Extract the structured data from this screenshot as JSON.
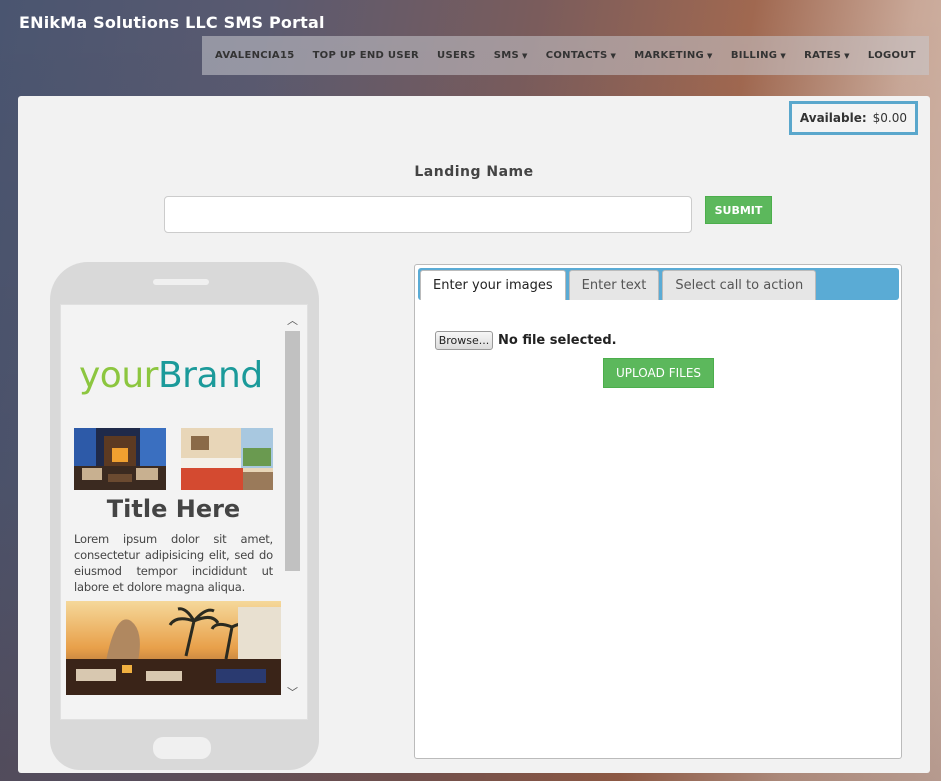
{
  "header": {
    "title": "ENikMa Solutions LLC SMS Portal"
  },
  "nav": {
    "items": [
      {
        "label": "AVALENCIA15",
        "dropdown": false
      },
      {
        "label": "TOP UP END USER",
        "dropdown": false
      },
      {
        "label": "USERS",
        "dropdown": false
      },
      {
        "label": "SMS",
        "dropdown": true
      },
      {
        "label": "CONTACTS",
        "dropdown": true
      },
      {
        "label": "MARKETING",
        "dropdown": true
      },
      {
        "label": "BILLING",
        "dropdown": true
      },
      {
        "label": "RATES",
        "dropdown": true
      },
      {
        "label": "LOGOUT",
        "dropdown": false
      }
    ]
  },
  "balance": {
    "label": "Available:",
    "value": "$0.00"
  },
  "landing": {
    "label": "Landing Name",
    "input_value": "",
    "submit_label": "SUBMIT"
  },
  "preview": {
    "brand_part1": "your",
    "brand_part2": "Brand",
    "title": "Title Here",
    "body": "Lorem ipsum dolor sit amet, consectetur adipisicing elit, sed do eiusmod tempor incididunt ut labore et dolore magna aliqua."
  },
  "tabs": [
    {
      "label": "Enter your images",
      "active": true
    },
    {
      "label": "Enter text",
      "active": false
    },
    {
      "label": "Select call to action",
      "active": false
    }
  ],
  "upload": {
    "browse_label": "Browse...",
    "file_status": "No file selected.",
    "upload_label": "UPLOAD FILES"
  },
  "colors": {
    "success": "#5cb85c",
    "accent_blue": "#5aabd5",
    "brand_green": "#8cc63f",
    "brand_teal": "#1b9a9a"
  }
}
